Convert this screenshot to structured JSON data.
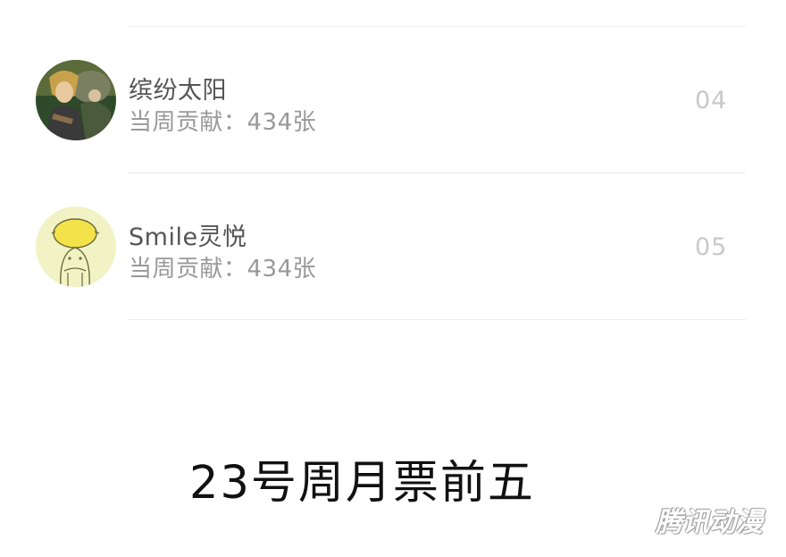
{
  "leaderboard": {
    "entries": [
      {
        "name": "缤纷太阳",
        "contribution": "当周贡献：434张",
        "rank": "04",
        "avatar_icon": "avatar-illustrated-character"
      },
      {
        "name": "Smile灵悦",
        "contribution": "当周贡献：434张",
        "rank": "05",
        "avatar_icon": "avatar-lemon-character"
      }
    ]
  },
  "caption": "23号周月票前五",
  "watermark": "腾讯动漫",
  "colors": {
    "name_text": "#555555",
    "contribution_text": "#999999",
    "rank_text": "#c9c9c9",
    "divider": "#ececec",
    "caption_text": "#111111"
  }
}
